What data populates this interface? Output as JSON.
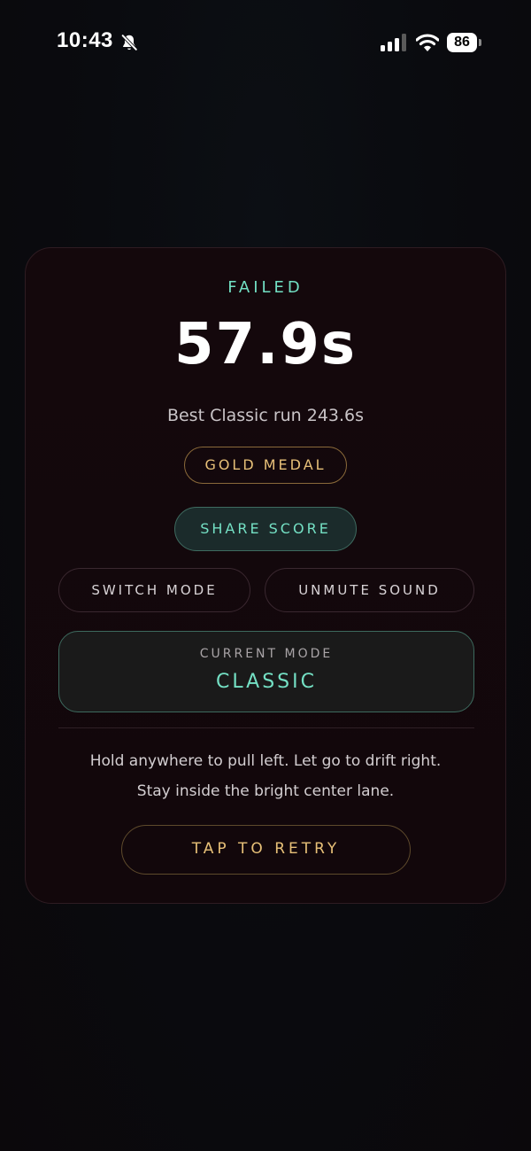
{
  "status_bar": {
    "time": "10:43",
    "battery_level": "86",
    "icons": [
      "bell-slash-icon",
      "signal-icon",
      "wifi-icon",
      "battery-icon"
    ]
  },
  "result": {
    "status": "FAILED",
    "score": "57.9s",
    "best_run": "Best Classic run 243.6s",
    "medal": "GOLD MEDAL"
  },
  "actions": {
    "share_label": "SHARE SCORE",
    "switch_mode_label": "SWITCH MODE",
    "unmute_label": "UNMUTE SOUND",
    "retry_label": "TAP TO RETRY"
  },
  "mode": {
    "caption": "CURRENT MODE",
    "value": "CLASSIC"
  },
  "instructions": [
    "Hold anywhere to pull left. Let go to drift right.",
    "Stay inside the bright center lane."
  ],
  "colors": {
    "accent_teal": "#74e0c4",
    "accent_gold": "#e7c078",
    "card_background": "#13070b"
  }
}
